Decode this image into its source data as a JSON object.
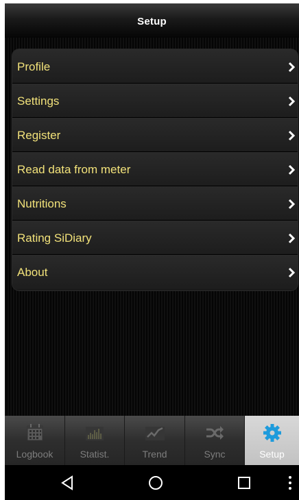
{
  "header": {
    "title": "Setup"
  },
  "menu": {
    "items": [
      {
        "label": "Profile"
      },
      {
        "label": "Settings"
      },
      {
        "label": "Register"
      },
      {
        "label": "Read data from meter"
      },
      {
        "label": "Nutritions"
      },
      {
        "label": "Rating SiDiary"
      },
      {
        "label": "About"
      }
    ],
    "label_color": "#f2e27a"
  },
  "tabbar": {
    "tabs": [
      {
        "label": "Logbook",
        "icon": "calendar-icon"
      },
      {
        "label": "Statist.",
        "icon": "bar-chart-icon"
      },
      {
        "label": "Trend",
        "icon": "trend-line-icon"
      },
      {
        "label": "Sync",
        "icon": "shuffle-icon"
      },
      {
        "label": "Setup",
        "icon": "gear-icon",
        "active": true
      }
    ],
    "active_color": "#1e9bdc"
  },
  "navbar": {
    "buttons": [
      "back-icon",
      "home-icon",
      "recents-icon",
      "menu-dots-icon"
    ]
  }
}
